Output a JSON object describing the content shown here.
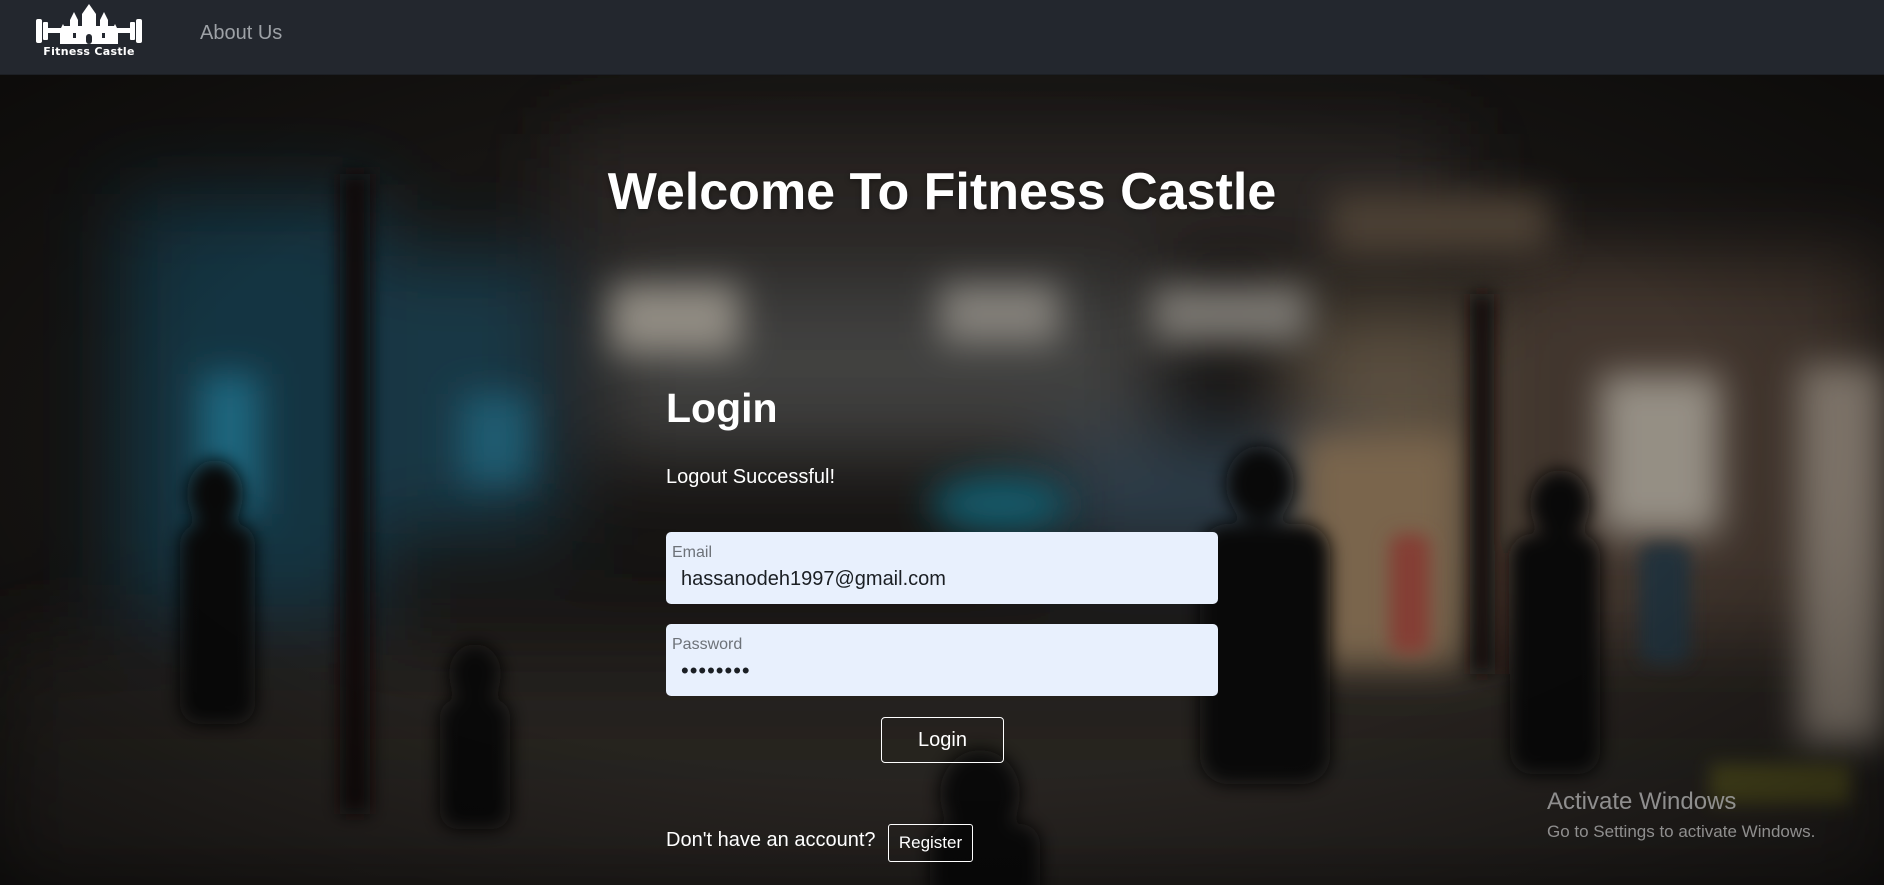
{
  "navbar": {
    "brand_text": "Fitness Castle",
    "links": [
      {
        "label": "About Us"
      }
    ]
  },
  "hero": {
    "title": "Welcome To Fitness Castle"
  },
  "login": {
    "heading": "Login",
    "flash_message": "Logout Successful!",
    "email": {
      "label": "Email",
      "value": "hassanodeh1997@gmail.com"
    },
    "password": {
      "label": "Password",
      "value": "********"
    },
    "submit_label": "Login",
    "register_prompt": "Don't have an account?",
    "register_label": "Register"
  },
  "watermark": {
    "title": "Activate Windows",
    "subtitle": "Go to Settings to activate Windows."
  },
  "colors": {
    "navbar_bg": "#23272e",
    "input_bg": "#e8f0fd",
    "text_primary": "#ffffff",
    "nav_link": "#9da1a6"
  },
  "icons": {
    "logo": "castle-dumbbell-logo"
  }
}
